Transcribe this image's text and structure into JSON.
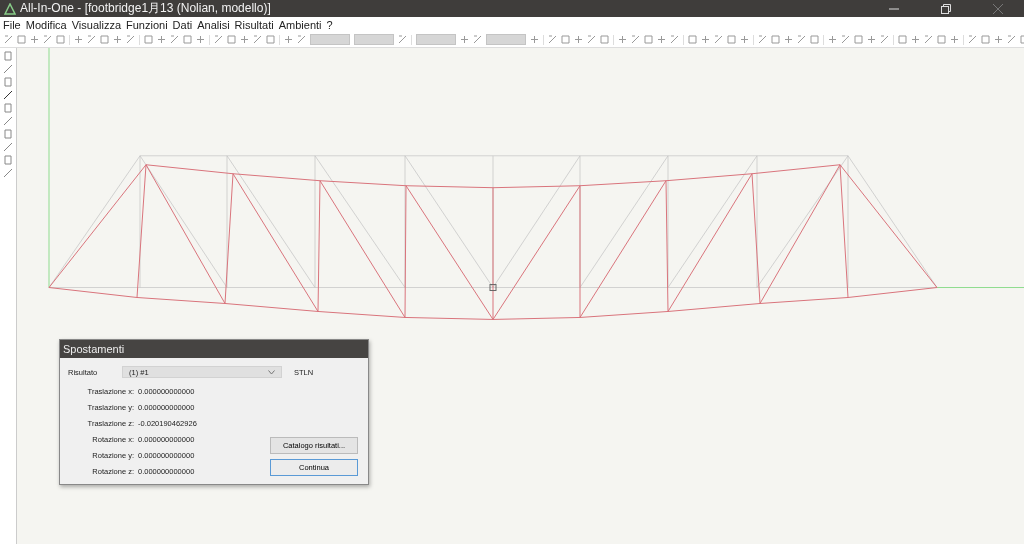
{
  "window": {
    "title": "All-In-One - [footbridge1月13 (Nolian, modello)]"
  },
  "menu": [
    "File",
    "Modifica",
    "Visualizza",
    "Funzioni",
    "Dati",
    "Analisi",
    "Risultati",
    "Ambienti",
    "?"
  ],
  "dialog": {
    "title": "Spostamenti",
    "result_label": "Risultato",
    "result_value": "(1) #1",
    "unit": "STLN",
    "rows": [
      {
        "label": "Traslazione x:",
        "value": "0.000000000000"
      },
      {
        "label": "Traslazione y:",
        "value": "0.000000000000"
      },
      {
        "label": "Traslazione z:",
        "value": "-0.020190462926"
      },
      {
        "label": "Rotazione x:",
        "value": "0.000000000000"
      },
      {
        "label": "Rotazione y:",
        "value": "0.000000000000"
      },
      {
        "label": "Rotazione z:",
        "value": "0.000000000000"
      }
    ],
    "buttons": [
      {
        "label": "Catalogo risultati...",
        "default": false
      },
      {
        "label": "Continua",
        "default": true
      }
    ]
  }
}
